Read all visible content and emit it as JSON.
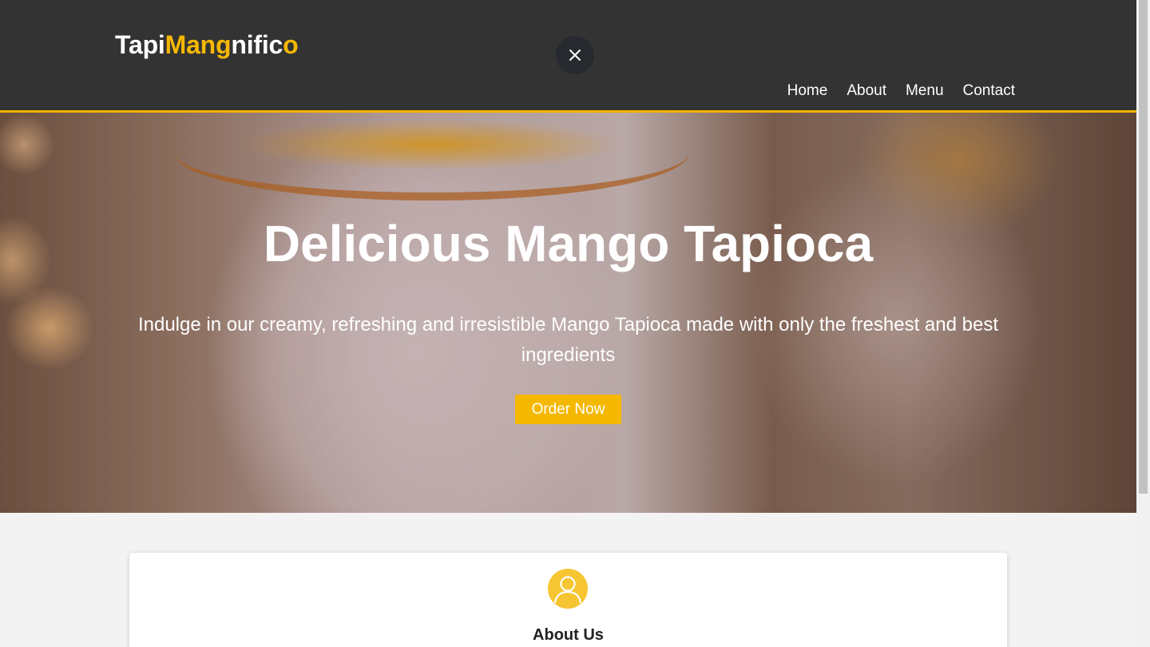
{
  "header": {
    "logo_parts": [
      "Tapi",
      "Mang",
      "nific",
      "o"
    ],
    "nav": [
      "Home",
      "About",
      "Menu",
      "Contact"
    ],
    "accent_color": "#f5b800",
    "close_icon": "close-icon"
  },
  "hero": {
    "title": "Delicious Mango Tapioca",
    "subtitle": "Indulge in our creamy, refreshing and irresistible Mango Tapioca made with only the freshest and best ingredients",
    "cta_label": "Order Now"
  },
  "about": {
    "icon": "user-icon",
    "title": "About Us"
  }
}
